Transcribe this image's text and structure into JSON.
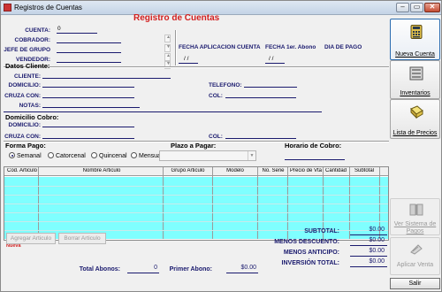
{
  "window": {
    "title": "Registros de Cuentas"
  },
  "heading": "Registro de Cuentas",
  "cuenta": {
    "cuenta_label": "CUENTA:",
    "cuenta_value": "0",
    "cobrador_label": "COBRADOR:",
    "jefe_label": "JEFE DE GRUPO",
    "vendedor_label": "VENDEDOR:"
  },
  "fechas": {
    "aplicacion_label": "FECHA APLICACION CUENTA",
    "aplicacion_value": "/ /",
    "abono_label": "FECHA 1er. Abono",
    "abono_value": "/ /",
    "dia_pago_label": "DIA DE PAGO"
  },
  "cliente": {
    "section": "Datos Cliente:",
    "cliente_label": "CLIENTE:",
    "domicilio_label": "DOMICILIO:",
    "telefono_label": "TELEFONO:",
    "cruza_label": "CRUZA CON:",
    "col_label": "COL:",
    "notas_label": "NOTAS:"
  },
  "cobro": {
    "section": "Domicilio Cobro:",
    "domicilio_label": "DOMICILIO:",
    "cruza_label": "CRUZA CON:",
    "col_label": "COL:"
  },
  "forma_pago": {
    "section": "Forma Pago:",
    "options": [
      "Semanal",
      "Catorcenal",
      "Quincenal",
      "Mensual"
    ],
    "selected": "Semanal"
  },
  "plazo": {
    "section": "Plazo a Pagar:"
  },
  "horario": {
    "section": "Horario de Cobro:"
  },
  "grid": {
    "columns": [
      "Cod. Articulo",
      "Nombre Articulo",
      "Grupo Articulo",
      "Modelo",
      "No. Serie",
      "Precio de Vta",
      "Cantidad",
      "Subtotal"
    ]
  },
  "actions": {
    "nueva": "Nueva",
    "agregar": "Agregar Articulo",
    "borrar": "Borrar Articulo"
  },
  "totals": {
    "subtotal_label": "SUBTOTAL:",
    "subtotal": "$0.00",
    "descuento_label": "MENOS DESCUENTO:",
    "descuento": "$0.00",
    "anticipo_label": "MENOS ANTICIPO:",
    "anticipo": "$0.00",
    "inversion_label": "INVERSIÓN TOTAL:",
    "inversion": "$0.00",
    "total_abonos_label": "Total Abonos:",
    "total_abonos": "0",
    "primer_abono_label": "Primer Abono:",
    "primer_abono": "$0.00"
  },
  "sidebar": {
    "nueva_cuenta": "Nueva Cuenta",
    "inventarios": "Inventarios",
    "lista_precios": "Lista de Precios",
    "ver_sistema": "Ver Sistema de Pagos",
    "aplicar_venta": "Aplicar Venta",
    "salir": "Salir"
  },
  "icons": {
    "calculator": "calculator-icon",
    "inventory": "inventory-icon",
    "price-list": "price-list-icon",
    "payments": "payments-icon",
    "apply-sale": "apply-sale-icon"
  }
}
